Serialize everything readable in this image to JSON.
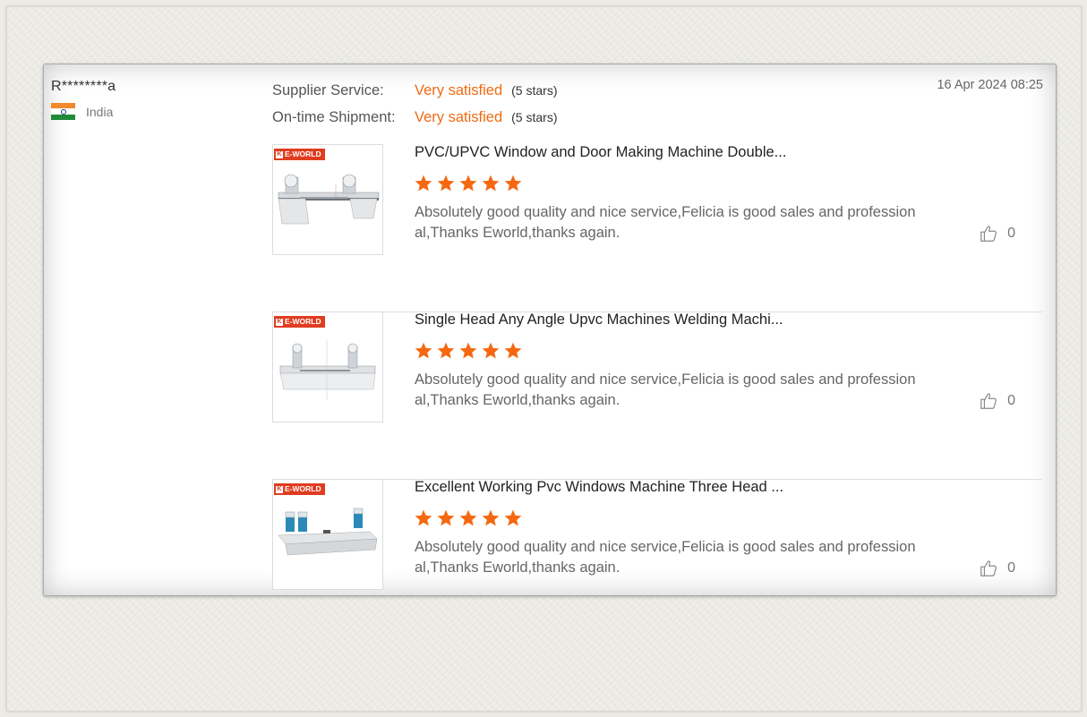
{
  "reviewer": {
    "name": "R********a",
    "country": "India"
  },
  "ratings": [
    {
      "label": "Supplier Service:",
      "value": "Very satisfied",
      "stars_text": "(5 stars)"
    },
    {
      "label": "On-time Shipment:",
      "value": "Very satisfied",
      "stars_text": "(5 stars)"
    }
  ],
  "date": "16 Apr 2024 08:25",
  "colors": {
    "accent": "#f06a13",
    "star": "#f5680f",
    "brand": "#e03c20"
  },
  "products": [
    {
      "title": "PVC/UPVC Window and Door Making Machine Double...",
      "brand_badge": "E-WORLD",
      "stars": 5,
      "review": "Absolutely good quality and nice service,Felicia is good sales and professional,Thanks Eworld,thanks again.",
      "likes": "0"
    },
    {
      "title": "Single Head Any Angle Upvc Machines Welding Machi...",
      "brand_badge": "E-WORLD",
      "stars": 5,
      "review": "Absolutely good quality and nice service,Felicia is good sales and professional,Thanks Eworld,thanks again.",
      "likes": "0"
    },
    {
      "title": "Excellent Working Pvc Windows Machine Three Head ...",
      "brand_badge": "E-WORLD",
      "stars": 5,
      "review": "Absolutely good quality and nice service,Felicia is good sales and professional,Thanks Eworld,thanks again.",
      "likes": "0"
    }
  ],
  "icons": {
    "like": "thumbs-up-icon",
    "star": "star-icon",
    "flag": "india-flag-icon"
  }
}
